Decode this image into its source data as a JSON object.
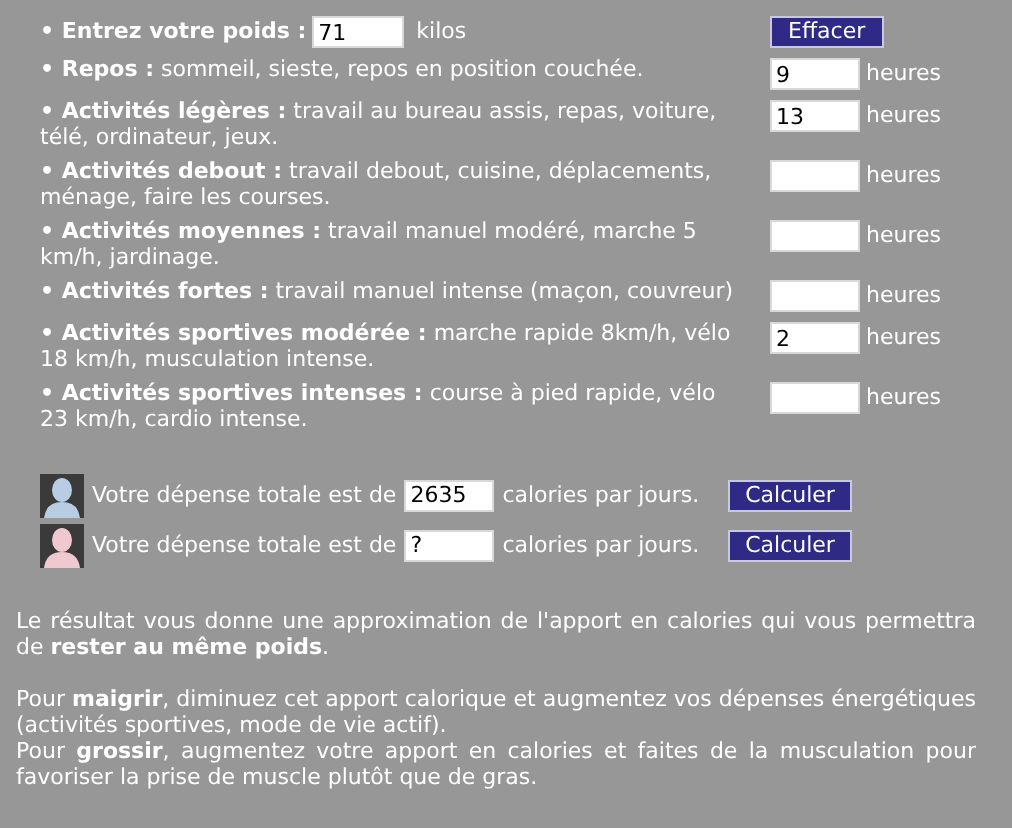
{
  "weight": {
    "label": "• Entrez votre poids :",
    "value": "71",
    "unit": "kilos"
  },
  "clear_button": "Effacer",
  "activities": [
    {
      "label": "**• Repos :** sommeil, sieste, repos en position couchée.",
      "value": "9",
      "unit": "heures"
    },
    {
      "label": "**• Activités légères :** travail au bureau assis, repas, voiture, télé, ordinateur, jeux.",
      "value": "13",
      "unit": "heures"
    },
    {
      "label": "**• Activités debout :** travail debout, cuisine, déplacements, ménage, faire les courses.",
      "unit": "heures"
    },
    {
      "label": "**• Activités moyennes :** travail manuel modéré, marche 5 km/h, jardinage.",
      "unit": "heures"
    },
    {
      "label": "**• Activités fortes :** travail manuel intense (maçon, couvreur)",
      "unit": "heures"
    },
    {
      "label": "**• Activités sportives modérée :** marche rapide 8km/h, vélo 18 km/h, musculation intense.",
      "value": "2",
      "unit": "heures"
    },
    {
      "label": "**• Activités sportives intenses :** course à pied rapide, vélo 23 km/h, cardio intense.",
      "unit": "heures"
    }
  ],
  "results": [
    {
      "kind": "male",
      "prefix": "Votre dépense totale est de",
      "value": "2635",
      "suffix": "calories par jours.",
      "button": "Calculer"
    },
    {
      "kind": "female",
      "prefix": "Votre dépense totale est de",
      "value": "?",
      "suffix": "calories par jours.",
      "button": "Calculer"
    }
  ],
  "paragraphs": [
    "Le résultat vous donne une approximation de l'apport en calories qui vous permettra de **rester au même poids**.",
    "Pour **maigrir**, diminuez cet apport calorique et augmentez vos dépenses énergétiques (activités sportives, mode de vie actif).",
    "Pour **grossir**, augmentez votre apport en calories et faites de la musculation pour favoriser la prise de muscle plutôt que de gras."
  ]
}
